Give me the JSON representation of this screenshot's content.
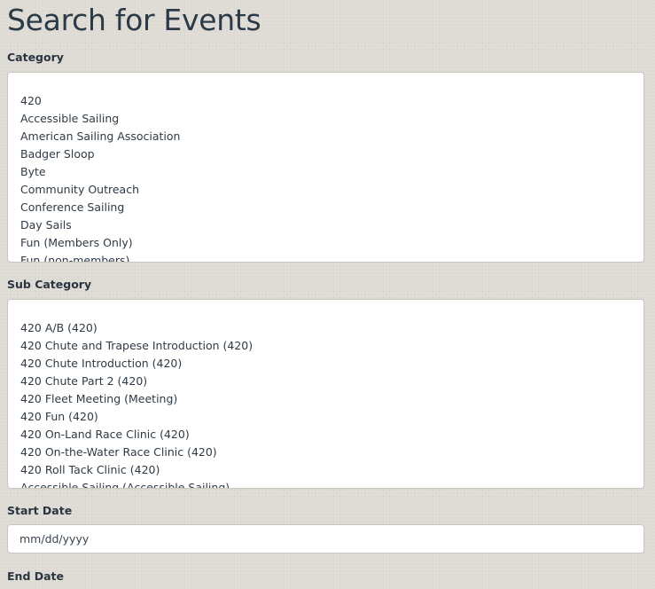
{
  "page": {
    "title": "Search for Events"
  },
  "category": {
    "label": "Category",
    "options": [
      "420",
      "Accessible Sailing",
      "American Sailing Association",
      "Badger Sloop",
      "Byte",
      "Community Outreach",
      "Conference Sailing",
      "Day Sails",
      "Fun (Members Only)",
      "Fun (non-members)"
    ]
  },
  "sub_category": {
    "label": "Sub Category",
    "options": [
      "420 A/B (420)",
      "420 Chute and Trapese Introduction (420)",
      "420 Chute Introduction (420)",
      "420 Chute Part 2 (420)",
      "420 Fleet Meeting (Meeting)",
      "420 Fun (420)",
      "420 On-Land Race Clinic (420)",
      "420 On-the-Water Race Clinic (420)",
      "420 Roll Tack Clinic (420)",
      "Accessible Sailing (Accessible Sailing)"
    ]
  },
  "start_date": {
    "label": "Start Date",
    "placeholder": "mm/dd/yyyy"
  },
  "end_date": {
    "label": "End Date"
  }
}
